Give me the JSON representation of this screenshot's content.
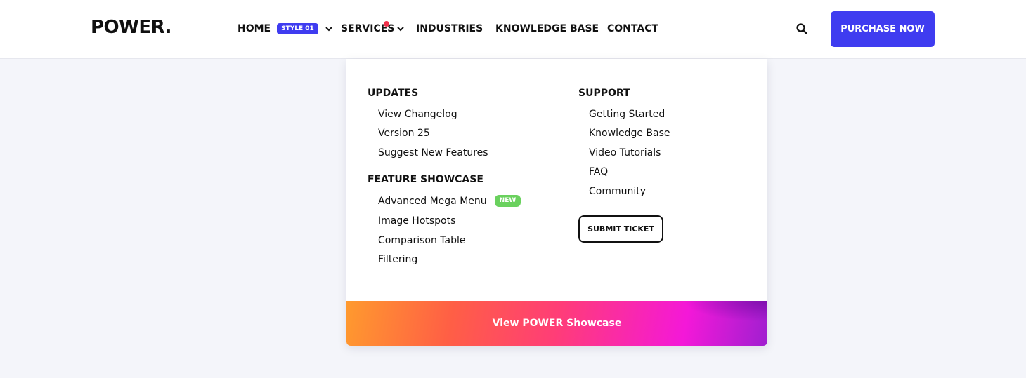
{
  "header": {
    "logo": "POWER.",
    "nav": {
      "home": "HOME",
      "home_badge": "STYLE 01",
      "services": "SERVICES",
      "industries": "INDUSTRIES",
      "knowledge_base": "KNOWLEDGE BASE",
      "contact": "CONTACT"
    },
    "purchase_label": "PURCHASE NOW"
  },
  "mega_menu": {
    "updates": {
      "title": "UPDATES",
      "items": [
        "View Changelog",
        "Version 25",
        "Suggest New Features"
      ]
    },
    "feature_showcase": {
      "title": "FEATURE SHOWCASE",
      "items": [
        "Advanced Mega Menu",
        "Image Hotspots",
        "Comparison Table",
        "Filtering"
      ],
      "new_badge": "NEW"
    },
    "support": {
      "title": "SUPPORT",
      "items": [
        "Getting Started",
        "Knowledge Base",
        "Video Tutorials",
        "FAQ",
        "Community"
      ],
      "ticket_label": "SUBMIT TICKET"
    },
    "showcase_label": "View POWER Showcase"
  },
  "colors": {
    "accent": "#3f3cf0",
    "notification_dot": "#f0304a",
    "new_badge": "#6ad15e",
    "background": "#f4f5fa"
  },
  "icons": [
    "chevron-down-icon",
    "search-icon"
  ]
}
